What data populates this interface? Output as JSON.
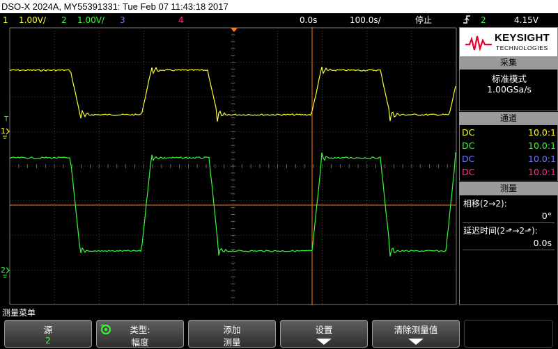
{
  "title_bar": "DSO-X 2024A, MY55391331: Tue Feb 07 11:43:18 2017",
  "status": {
    "ch1_num": "1",
    "ch1_scale": "1.00V/",
    "ch2_num": "2",
    "ch2_scale": "1.00V/",
    "ch3_num": "3",
    "ch4_num": "4",
    "time_delay": "0.0s",
    "time_scale": "100.0s/",
    "run_state": "停止",
    "trigger_icon": "trigger-edge-icon",
    "trigger_source": "2",
    "trigger_level": "4.15V"
  },
  "colors": {
    "ch1": "#ffff2e",
    "ch2": "#33ff33",
    "ch3": "#6f7cff",
    "ch4": "#ff2e8f",
    "trigger_line": "#ff7a1a",
    "grid": "#7a7a7a"
  },
  "markers": {
    "trigger_level_mark": "T",
    "ch1_mark": "1",
    "ch2_mark": "2"
  },
  "side_panel": {
    "logo_name": "KEYSIGHT",
    "logo_sub": "TECHNOLOGIES",
    "acq_title": "采集",
    "acq_mode": "标准模式",
    "acq_rate": "1.00GSa/s",
    "channel_title": "通道",
    "channels": [
      {
        "coupling": "DC",
        "probe": "10.0:1"
      },
      {
        "coupling": "DC",
        "probe": "10.0:1"
      },
      {
        "coupling": "DC",
        "probe": "10.0:1"
      },
      {
        "coupling": "DC",
        "probe": "10.0:1"
      }
    ],
    "meas_title": "测量",
    "meas": [
      {
        "label": "相移(2→2):",
        "value": "0°"
      },
      {
        "label": "延迟时间(2⬏→2⬏):",
        "value": "0.0s"
      }
    ]
  },
  "softkeys": {
    "menu_title": "测量菜单",
    "keys": [
      {
        "label": "源",
        "value": "2"
      },
      {
        "label": "类型:",
        "value": "幅度"
      },
      {
        "label": "添加",
        "value": "测量"
      },
      {
        "label": "设置",
        "value": ""
      },
      {
        "label": "清除测量值",
        "value": ""
      }
    ]
  }
}
